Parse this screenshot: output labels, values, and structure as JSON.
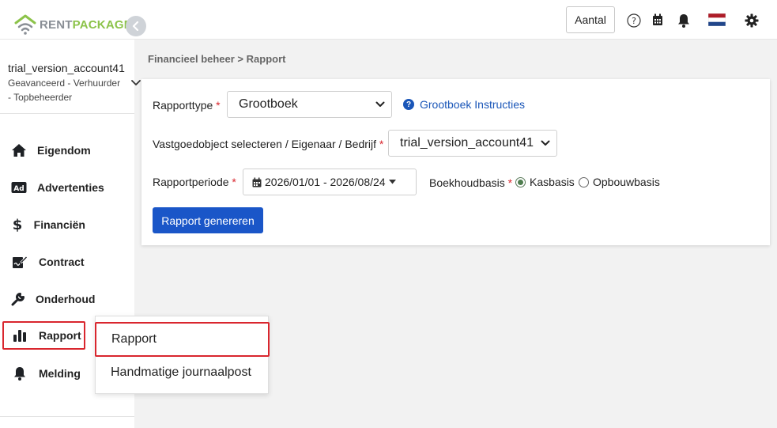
{
  "logo": {
    "rent": "RENT",
    "package": "PACKAGE"
  },
  "topbar": {
    "aantal_label": "Aantal"
  },
  "account": {
    "name": "trial_version_account41",
    "role_line1": "Geavanceerd - Verhuurder",
    "role_line2": "- Topbeheerder"
  },
  "sidebar": {
    "items": [
      {
        "label": "Eigendom",
        "icon": "home-icon"
      },
      {
        "label": "Advertenties",
        "icon": "ad-icon"
      },
      {
        "label": "Financiën",
        "icon": "dollar-icon"
      },
      {
        "label": "Contract",
        "icon": "contract-icon"
      },
      {
        "label": "Onderhoud",
        "icon": "wrench-icon"
      },
      {
        "label": "Rapport",
        "icon": "bar-chart-icon"
      },
      {
        "label": "Melding",
        "icon": "bell-icon"
      }
    ]
  },
  "flyout": {
    "items": [
      {
        "label": "Rapport"
      },
      {
        "label": "Handmatige journaalpost"
      }
    ]
  },
  "breadcrumb": "Financieel beheer > Rapport",
  "form": {
    "rapporttype_label": "Rapporttype",
    "rapporttype_value": "Grootboek",
    "instructions_link": "Grootboek Instructies",
    "object_label": "Vastgoedobject selecteren / Eigenaar / Bedrijf",
    "object_value": "trial_version_account41",
    "period_label": "Rapportperiode",
    "period_value": "2026/01/01 - 2026/08/24",
    "basis_label": "Boekhoudbasis",
    "basis_options": [
      "Kasbasis",
      "Opbouwbasis"
    ],
    "basis_selected": "Kasbasis",
    "required_mark": "*",
    "generate_button": "Rapport genereren"
  },
  "colors": {
    "primary": "#1a56c8",
    "highlight": "#d9262e",
    "logo_green": "#8cc34a"
  }
}
